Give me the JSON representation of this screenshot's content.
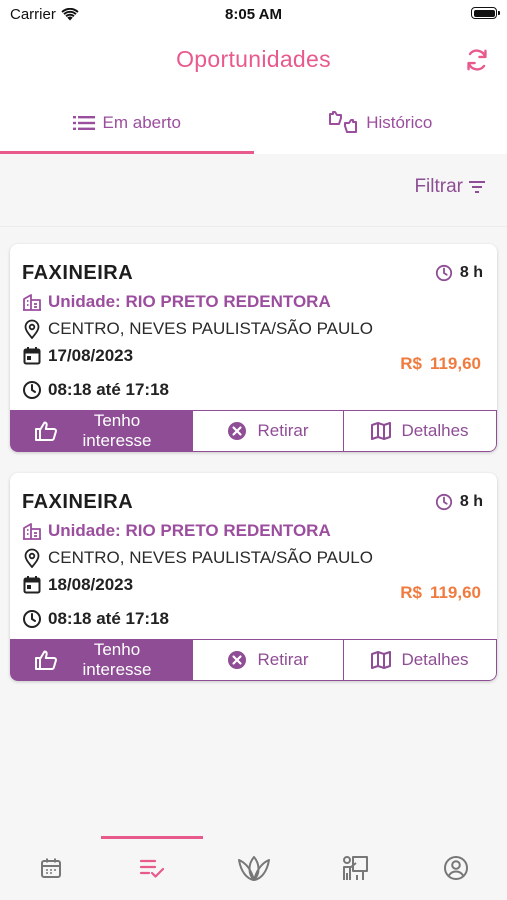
{
  "status": {
    "carrier": "Carrier",
    "time": "8:05 AM"
  },
  "header": {
    "title": "Oportunidades"
  },
  "tabs": [
    {
      "label": "Em aberto",
      "icon": "list-icon",
      "active": true
    },
    {
      "label": "Histórico",
      "icon": "handshake-icon",
      "active": false
    }
  ],
  "filter": {
    "label": "Filtrar"
  },
  "accent": {
    "pink": "#e8598c",
    "purple": "#8e4d95",
    "orange": "#f07b3f"
  },
  "cards": [
    {
      "title": "FAXINEIRA",
      "hours": "8 h",
      "unit": "Unidade: RIO PRETO REDENTORA",
      "location": "CENTRO, NEVES PAULISTA/SÃO PAULO",
      "date": "17/08/2023",
      "currency": "R$",
      "amount": "119,60",
      "time": "08:18 até 17:18",
      "interest_label": "Tenho interesse",
      "remove_label": "Retirar",
      "details_label": "Detalhes"
    },
    {
      "title": "FAXINEIRA",
      "hours": "8 h",
      "unit": "Unidade: RIO PRETO REDENTORA",
      "location": "CENTRO, NEVES PAULISTA/SÃO PAULO",
      "date": "18/08/2023",
      "currency": "R$",
      "amount": "119,60",
      "time": "08:18 até 17:18",
      "interest_label": "Tenho interesse",
      "remove_label": "Retirar",
      "details_label": "Detalhes"
    }
  ],
  "bottom_nav": [
    {
      "icon": "calendar-icon",
      "active": false
    },
    {
      "icon": "checklist-icon",
      "active": true
    },
    {
      "icon": "lotus-icon",
      "active": false
    },
    {
      "icon": "presenter-icon",
      "active": false
    },
    {
      "icon": "profile-icon",
      "active": false
    }
  ]
}
